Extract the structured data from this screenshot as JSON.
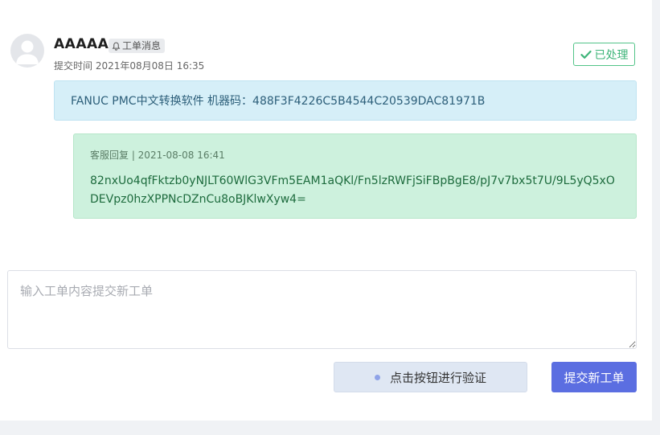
{
  "ticket": {
    "username": "AAAAA",
    "tag": {
      "icon": "bell-icon",
      "label": "工单消息"
    },
    "submit_time": "提交时间 2021年08月08日 16:35",
    "status": {
      "icon": "check-icon",
      "label": "已处理",
      "color": "#3fb57a"
    },
    "message": "FANUC PMC中文转换软件 机器码：488F3F4226C5B4544C20539DAC81971B"
  },
  "reply": {
    "meta": "客服回复 | 2021-08-08 16:41",
    "content": "82nxUo4qfFktzb0yNJLT60WlG3VFm5EAM1aQKl/Fn5lzRWFjSiFBpBgE8/pJ7v7bx5t7U/9L5yQ5xODEVpz0hzXPPNcDZnCu8oBJKlwXyw4="
  },
  "form": {
    "textarea_placeholder": "输入工单内容提交新工单",
    "textarea_value": "",
    "verify_label": "点击按钮进行验证",
    "submit_label": "提交新工单",
    "accent_color": "#5b6ee1"
  }
}
